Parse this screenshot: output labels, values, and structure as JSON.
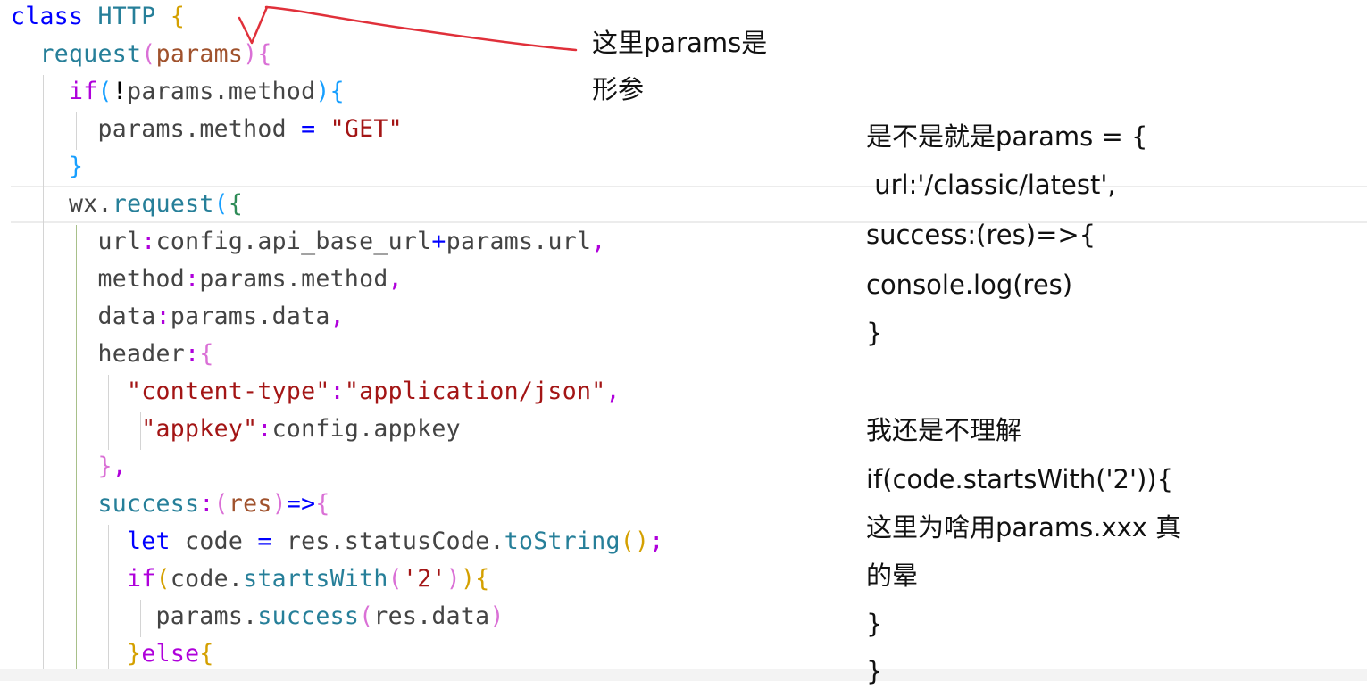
{
  "editor": {
    "lines": [
      [
        [
          "class ",
          "#0000ff"
        ],
        [
          "HTTP ",
          "#267f99"
        ],
        [
          "{",
          "#d4a000"
        ]
      ],
      [
        [
          "  ",
          "#000000"
        ],
        [
          "request",
          "#267f99"
        ],
        [
          "(",
          "#da70d6"
        ],
        [
          "params",
          "#a0522d"
        ],
        [
          "){",
          "#da70d6"
        ]
      ],
      [
        [
          "    ",
          "#000000"
        ],
        [
          "if",
          "#af00db"
        ],
        [
          "(",
          "#179fff"
        ],
        [
          "!",
          "#000000"
        ],
        [
          "params",
          "#444444"
        ],
        [
          ".",
          "#444444"
        ],
        [
          "method",
          "#444444"
        ],
        [
          "){",
          "#179fff"
        ]
      ],
      [
        [
          "      ",
          "#000000"
        ],
        [
          "params",
          "#444444"
        ],
        [
          ".",
          "#444444"
        ],
        [
          "method ",
          "#444444"
        ],
        [
          "= ",
          "#0000ff"
        ],
        [
          "\"GET\"",
          "#a31515"
        ]
      ],
      [
        [
          "    ",
          "#000000"
        ],
        [
          "}",
          "#179fff"
        ]
      ],
      [
        [
          "    ",
          "#000000"
        ],
        [
          "wx",
          "#444444"
        ],
        [
          ".",
          "#444444"
        ],
        [
          "request",
          "#267f99"
        ],
        [
          "(",
          "#179fff"
        ],
        [
          "{",
          "#2e8b57"
        ]
      ],
      [
        [
          "      ",
          "#000000"
        ],
        [
          "url",
          "#444444"
        ],
        [
          ":",
          "#af00db"
        ],
        [
          "config",
          "#444444"
        ],
        [
          ".",
          "#444444"
        ],
        [
          "api_base_url",
          "#444444"
        ],
        [
          "+",
          "#0000ff"
        ],
        [
          "params",
          "#444444"
        ],
        [
          ".",
          "#444444"
        ],
        [
          "url",
          "#444444"
        ],
        [
          ",",
          "#af00db"
        ]
      ],
      [
        [
          "      ",
          "#000000"
        ],
        [
          "method",
          "#444444"
        ],
        [
          ":",
          "#af00db"
        ],
        [
          "params",
          "#444444"
        ],
        [
          ".",
          "#444444"
        ],
        [
          "method",
          "#444444"
        ],
        [
          ",",
          "#af00db"
        ]
      ],
      [
        [
          "      ",
          "#000000"
        ],
        [
          "data",
          "#444444"
        ],
        [
          ":",
          "#af00db"
        ],
        [
          "params",
          "#444444"
        ],
        [
          ".",
          "#444444"
        ],
        [
          "data",
          "#444444"
        ],
        [
          ",",
          "#af00db"
        ]
      ],
      [
        [
          "      ",
          "#000000"
        ],
        [
          "header",
          "#444444"
        ],
        [
          ":",
          "#af00db"
        ],
        [
          "{",
          "#da70d6"
        ]
      ],
      [
        [
          "        ",
          "#000000"
        ],
        [
          "\"content-type\"",
          "#a31515"
        ],
        [
          ":",
          "#af00db"
        ],
        [
          "\"application/json\"",
          "#a31515"
        ],
        [
          ",",
          "#af00db"
        ]
      ],
      [
        [
          "         ",
          "#000000"
        ],
        [
          "\"appkey\"",
          "#a31515"
        ],
        [
          ":",
          "#af00db"
        ],
        [
          "config",
          "#444444"
        ],
        [
          ".",
          "#444444"
        ],
        [
          "appkey",
          "#444444"
        ]
      ],
      [
        [
          "      ",
          "#000000"
        ],
        [
          "}",
          "#da70d6"
        ],
        [
          ",",
          "#af00db"
        ]
      ],
      [
        [
          "      ",
          "#000000"
        ],
        [
          "success",
          "#267f99"
        ],
        [
          ":",
          "#af00db"
        ],
        [
          "(",
          "#da70d6"
        ],
        [
          "res",
          "#a0522d"
        ],
        [
          ")",
          "#da70d6"
        ],
        [
          "=>",
          "#0000ff"
        ],
        [
          "{",
          "#da70d6"
        ]
      ],
      [
        [
          "        ",
          "#000000"
        ],
        [
          "let ",
          "#0000ff"
        ],
        [
          "code ",
          "#444444"
        ],
        [
          "= ",
          "#0000ff"
        ],
        [
          "res",
          "#444444"
        ],
        [
          ".",
          "#444444"
        ],
        [
          "statusCode",
          "#444444"
        ],
        [
          ".",
          "#444444"
        ],
        [
          "toString",
          "#267f99"
        ],
        [
          "()",
          "#d4a000"
        ],
        [
          ";",
          "#af00db"
        ]
      ],
      [
        [
          "        ",
          "#000000"
        ],
        [
          "if",
          "#af00db"
        ],
        [
          "(",
          "#d4a000"
        ],
        [
          "code",
          "#444444"
        ],
        [
          ".",
          "#444444"
        ],
        [
          "startsWith",
          "#267f99"
        ],
        [
          "(",
          "#da70d6"
        ],
        [
          "'2'",
          "#a31515"
        ],
        [
          ")",
          "#da70d6"
        ],
        [
          ")",
          "#d4a000"
        ],
        [
          "{",
          "#d4a000"
        ]
      ],
      [
        [
          "          ",
          "#000000"
        ],
        [
          "params",
          "#444444"
        ],
        [
          ".",
          "#444444"
        ],
        [
          "success",
          "#267f99"
        ],
        [
          "(",
          "#da70d6"
        ],
        [
          "res",
          "#444444"
        ],
        [
          ".",
          "#444444"
        ],
        [
          "data",
          "#444444"
        ],
        [
          ")",
          "#da70d6"
        ]
      ],
      [
        [
          "        ",
          "#000000"
        ],
        [
          "}",
          "#d4a000"
        ],
        [
          "else",
          "#af00db"
        ],
        [
          "{",
          "#d4a000"
        ]
      ]
    ]
  },
  "annotation_top": [
    "这里params是",
    "形参"
  ],
  "annotation_right": [
    "是不是就是params = {",
    " url:'/classic/latest',",
    "success:(res)=>{",
    "console.log(res)",
    "}",
    "",
    "我还是不理解",
    "if(code.startsWith('2')){",
    "这里为啥用params.xxx 真",
    "的晕",
    "}",
    "}"
  ],
  "colors": {
    "keyword": "#0000ff",
    "control": "#af00db",
    "type": "#267f99",
    "string": "#a31515",
    "param": "#a0522d",
    "arrow": "#e0303a"
  }
}
